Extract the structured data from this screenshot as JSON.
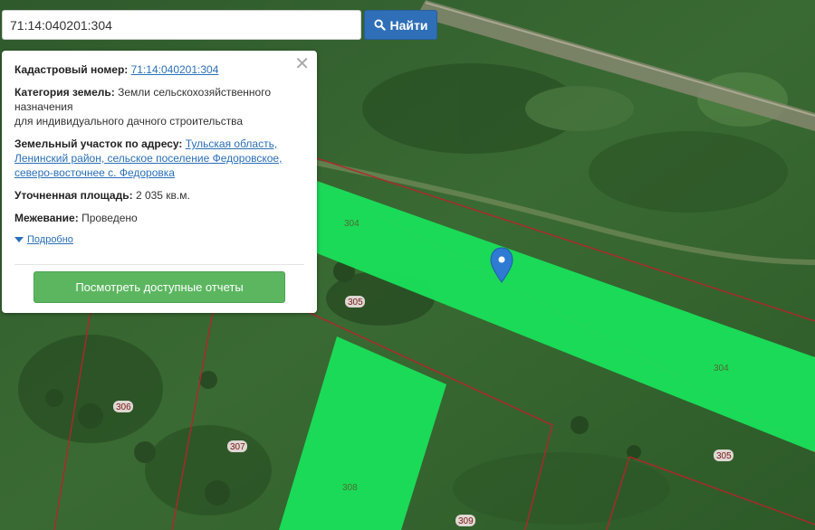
{
  "search": {
    "value": "71:14:040201:304",
    "button_label": "Найти",
    "button_icon": "search-icon"
  },
  "popup": {
    "cadastral_label": "Кадастровый номер:",
    "cadastral_value": "71:14:040201:304",
    "category_label": "Категория земель:",
    "category_line1": "Земли сельскохозяйственного",
    "category_line2": "назначения",
    "category_line3": "для индивидуального дачного строительства",
    "address_label": "Земельный участок по адресу:",
    "address_line1": "Тульская область,",
    "address_line2": "Ленинский район, сельское поселение Федоровское,",
    "address_line3": "северо-восточнее с. Федоровка",
    "area_label": "Уточненная площадь:",
    "area_value": "2 035 кв.м.",
    "survey_label": "Межевание:",
    "survey_value": "Проведено",
    "more_label": "Подробно",
    "report_button": "Посмотреть доступные отчеты",
    "close_icon": "close-icon"
  },
  "map": {
    "parcel_labels": {
      "p304a": "304",
      "p304b": "304",
      "p305a": "305",
      "p305b": "305",
      "p306": "306",
      "p307": "307",
      "p308": "308",
      "p309": "309"
    },
    "highlight_color": "#19e05a",
    "boundary_color": "#b8232a"
  }
}
